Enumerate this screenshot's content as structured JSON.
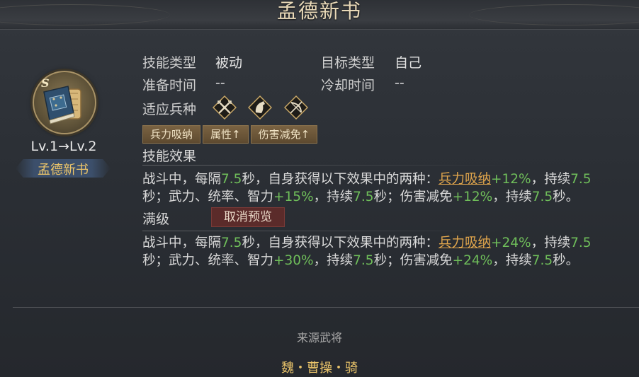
{
  "header": {
    "title": "孟德新书"
  },
  "skill": {
    "grade_badge": "S",
    "level_text": "Lv.1→Lv.2",
    "name": "孟德新书",
    "icon": "book-scroll-icon"
  },
  "info": {
    "skill_type_label": "技能类型",
    "skill_type_value": "被动",
    "target_type_label": "目标类型",
    "target_type_value": "自己",
    "prep_time_label": "准备时间",
    "prep_time_value": "--",
    "cooldown_label": "冷却时间",
    "cooldown_value": "--",
    "troop_label": "适应兵种",
    "troop_icons": [
      "spear-troop-icon",
      "cavalry-troop-icon",
      "archer-troop-icon"
    ]
  },
  "tags": [
    "兵力吸纳",
    "属性↑",
    "伤害减免↑"
  ],
  "effect": {
    "title": "技能效果",
    "line1": {
      "t1": "战斗中，每隔",
      "n1": "7.5",
      "t2": "秒，自身获得以下效果中的两种：",
      "k1": "兵力吸纳",
      "n2": "+12%",
      "t3": "，持续",
      "n3": "7.5"
    },
    "line2": {
      "t1": "秒；武力、统率、智力",
      "n1": "+15%",
      "t2": "，持续",
      "n2": "7.5",
      "t3": "秒；伤害减免",
      "n3": "+12%",
      "t4": "，持续",
      "n4": "7.5",
      "t5": "秒。"
    }
  },
  "max_level": {
    "title": "满级",
    "cancel_preview_label": "取消预览",
    "line1": {
      "t1": "战斗中，每隔",
      "n1": "7.5",
      "t2": "秒，自身获得以下效果中的两种：",
      "k1": "兵力吸纳",
      "n2": "+24%",
      "t3": "，持续",
      "n3": "7.5"
    },
    "line2": {
      "t1": "秒；武力、统率、智力",
      "n1": "+30%",
      "t2": "，持续",
      "n2": "7.5",
      "t3": "秒；伤害减免",
      "n3": "+24%",
      "t4": "，持续",
      "n4": "7.5",
      "t5": "秒。"
    }
  },
  "source": {
    "label": "来源武将",
    "value": "魏・曹操・骑"
  },
  "colors": {
    "accent_gold": "#eac46a",
    "value_green": "#6fbe5a",
    "keyword_orange": "#e0a54c",
    "cancel_red": "#5b2b2a"
  }
}
